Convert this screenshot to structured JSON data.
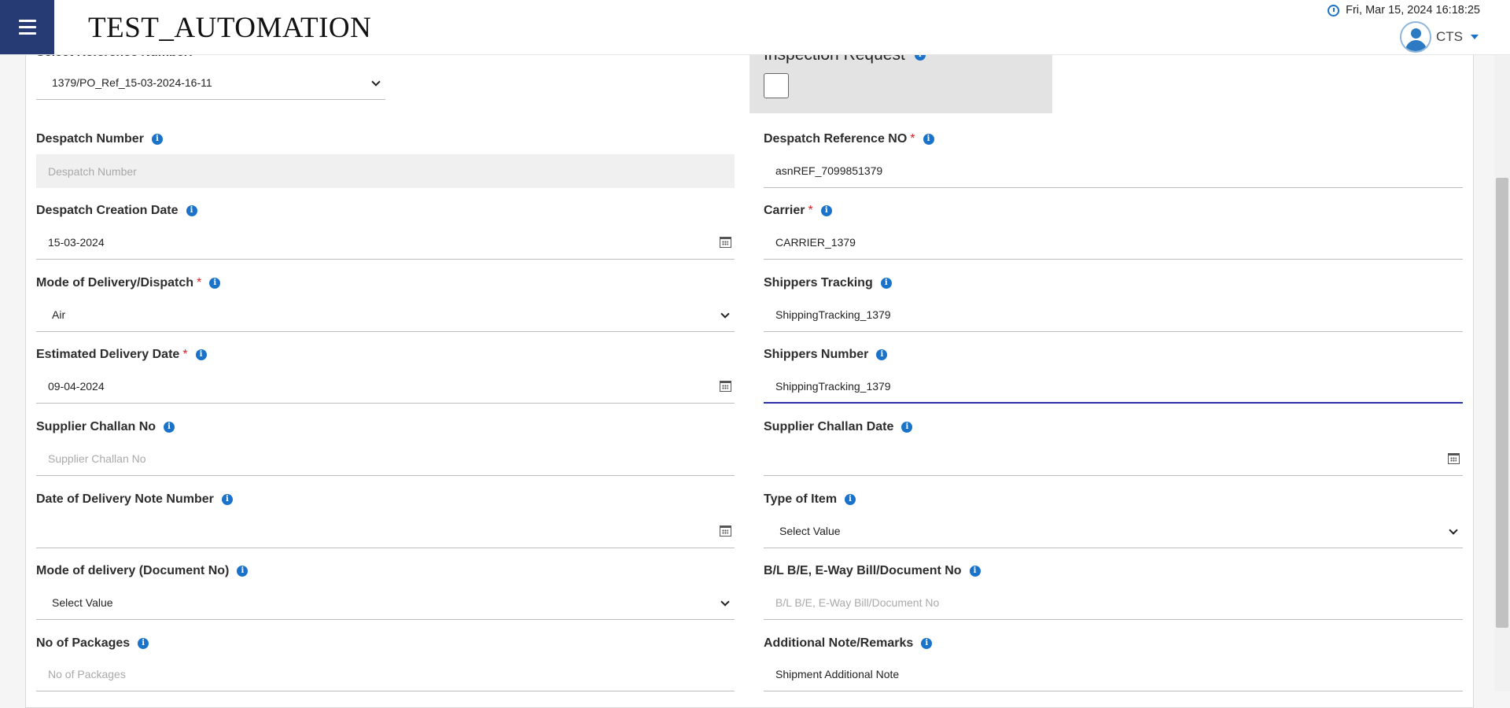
{
  "header": {
    "title": "TEST_AUTOMATION",
    "datetime": "Fri, Mar 15, 2024 16:18:25",
    "user": "CTS"
  },
  "form": {
    "reference": {
      "label": "Select Reference Number:",
      "value": "1379/PO_Ref_15-03-2024-16-11"
    },
    "inspection": {
      "label": "Inspection Request"
    },
    "despatch_number": {
      "label": "Despatch Number",
      "placeholder": "Despatch Number"
    },
    "despatch_reference": {
      "label": "Despatch Reference NO",
      "value": "asnREF_7099851379"
    },
    "despatch_creation_date": {
      "label": "Despatch Creation Date",
      "value": "15-03-2024"
    },
    "carrier": {
      "label": "Carrier",
      "value": "CARRIER_1379"
    },
    "mode_of_delivery": {
      "label": "Mode of Delivery/Dispatch",
      "value": "Air"
    },
    "shippers_tracking": {
      "label": "Shippers Tracking",
      "value": "ShippingTracking_1379"
    },
    "estimated_delivery_date": {
      "label": "Estimated Delivery Date",
      "value": "09-04-2024"
    },
    "shippers_number": {
      "label": "Shippers Number",
      "value": "ShippingTracking_1379"
    },
    "supplier_challan_no": {
      "label": "Supplier Challan No",
      "placeholder": "Supplier Challan No"
    },
    "supplier_challan_date": {
      "label": "Supplier Challan Date"
    },
    "delivery_note_date": {
      "label": "Date of Delivery Note Number"
    },
    "type_of_item": {
      "label": "Type of Item",
      "value": "Select Value"
    },
    "mode_of_delivery_doc": {
      "label": "Mode of delivery (Document No)",
      "value": "Select Value"
    },
    "bl_document_no": {
      "label": "B/L B/E, E-Way Bill/Document No",
      "placeholder": "B/L B/E, E-Way Bill/Document No"
    },
    "no_of_packages": {
      "label": "No of Packages",
      "placeholder": "No of Packages"
    },
    "additional_note": {
      "label": "Additional Note/Remarks",
      "value": "Shipment Additional Note"
    }
  },
  "colors": {
    "brand": "#263a74",
    "accent": "#1a73c9",
    "required": "#e02020",
    "focus": "#2b2fb0"
  },
  "icons": [
    "menu-icon",
    "clock-icon",
    "user-avatar-icon",
    "info-icon",
    "calendar-icon",
    "chevron-down-icon"
  ]
}
